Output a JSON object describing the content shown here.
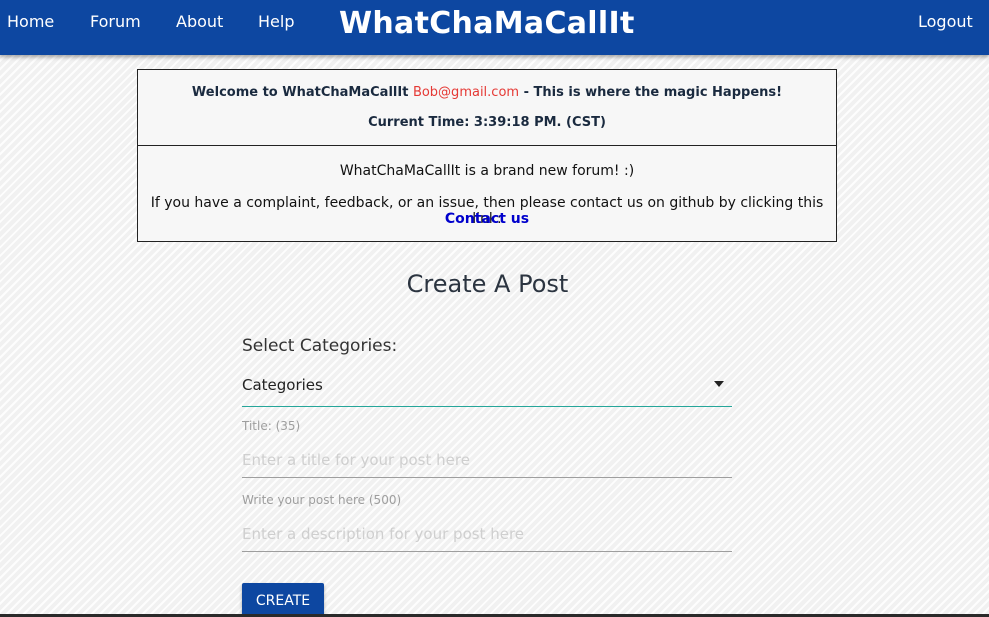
{
  "colors": {
    "navbar": "#0d47a1",
    "email": "#e53935",
    "link": "#0000cc",
    "accent_underline": "#26a69a"
  },
  "nav": {
    "home": "Home",
    "forum": "Forum",
    "about": "About",
    "help": "Help",
    "brand": "WhatChaMaCallIt",
    "logout": "Logout"
  },
  "info": {
    "welcome_prefix": "Welcome to WhatChaMaCallIt",
    "email": "Bob@gmail.com",
    "welcome_suffix": "- This is where the magic Happens!",
    "current_time": "Current Time: 3:39:18 PM. (CST)",
    "forum_note": "WhatChaMaCallIt is a brand new forum! :)",
    "complaint_note": "If you have a complaint, feedback, or an issue, then please contact us on github by clicking this link:",
    "contact_link": "Contact us"
  },
  "form": {
    "heading": "Create A Post",
    "categories_label": "Select Categories:",
    "categories_value": "Categories",
    "title_label": "Title: (35)",
    "title_placeholder": "Enter a title for your post here",
    "body_label": "Write your post here (500)",
    "body_placeholder": "Enter a description for your post here",
    "submit": "CREATE"
  }
}
